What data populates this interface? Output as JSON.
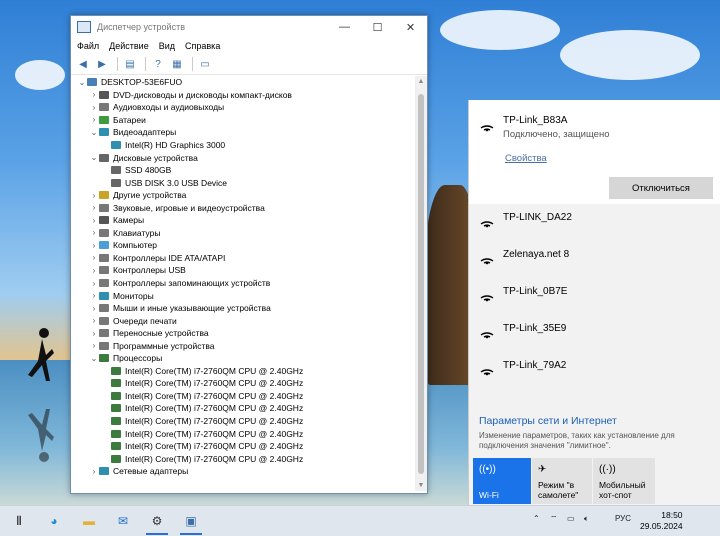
{
  "device_manager": {
    "title": "Диспетчер устройств",
    "menu": [
      "Файл",
      "Действие",
      "Вид",
      "Справка"
    ],
    "tree": [
      {
        "level": 0,
        "exp": "v",
        "icon": "computer-icon",
        "color": "#4a7fb5",
        "label": "DESKTOP-53E6FUO"
      },
      {
        "level": 1,
        "exp": ">",
        "icon": "dvd-icon",
        "color": "#555",
        "label": "DVD-дисководы и дисководы компакт-дисков"
      },
      {
        "level": 1,
        "exp": ">",
        "icon": "audio-icon",
        "color": "#777",
        "label": "Аудиовходы и аудиовыходы"
      },
      {
        "level": 1,
        "exp": ">",
        "icon": "battery-icon",
        "color": "#3d9a3d",
        "label": "Батареи"
      },
      {
        "level": 1,
        "exp": "v",
        "icon": "display-adapter-icon",
        "color": "#2f8fb0",
        "label": "Видеоадаптеры"
      },
      {
        "level": 2,
        "exp": "",
        "icon": "display-adapter-icon",
        "color": "#2f8fb0",
        "label": "Intel(R) HD Graphics 3000"
      },
      {
        "level": 1,
        "exp": "v",
        "icon": "disk-icon",
        "color": "#666",
        "label": "Дисковые устройства"
      },
      {
        "level": 2,
        "exp": "",
        "icon": "disk-icon",
        "color": "#666",
        "label": "SSD 480GB"
      },
      {
        "level": 2,
        "exp": "",
        "icon": "disk-icon",
        "color": "#666",
        "label": "USB DISK 3.0 USB Device"
      },
      {
        "level": 1,
        "exp": ">",
        "icon": "other-devices-icon",
        "color": "#c9a227",
        "label": "Другие устройства"
      },
      {
        "level": 1,
        "exp": ">",
        "icon": "sound-icon",
        "color": "#777",
        "label": "Звуковые, игровые и видеоустройства"
      },
      {
        "level": 1,
        "exp": ">",
        "icon": "camera-icon",
        "color": "#555",
        "label": "Камеры"
      },
      {
        "level": 1,
        "exp": ">",
        "icon": "keyboard-icon",
        "color": "#777",
        "label": "Клавиатуры"
      },
      {
        "level": 1,
        "exp": ">",
        "icon": "computer-icon",
        "color": "#4a9fd6",
        "label": "Компьютер"
      },
      {
        "level": 1,
        "exp": ">",
        "icon": "ide-controller-icon",
        "color": "#777",
        "label": "Контроллеры IDE ATA/ATAPI"
      },
      {
        "level": 1,
        "exp": ">",
        "icon": "usb-icon",
        "color": "#777",
        "label": "Контроллеры USB"
      },
      {
        "level": 1,
        "exp": ">",
        "icon": "storage-controller-icon",
        "color": "#777",
        "label": "Контроллеры запоминающих устройств"
      },
      {
        "level": 1,
        "exp": ">",
        "icon": "monitor-icon",
        "color": "#2f8fb0",
        "label": "Мониторы"
      },
      {
        "level": 1,
        "exp": ">",
        "icon": "mouse-icon",
        "color": "#777",
        "label": "Мыши и иные указывающие устройства"
      },
      {
        "level": 1,
        "exp": ">",
        "icon": "print-queue-icon",
        "color": "#777",
        "label": "Очереди печати"
      },
      {
        "level": 1,
        "exp": ">",
        "icon": "portable-device-icon",
        "color": "#777",
        "label": "Переносные устройства"
      },
      {
        "level": 1,
        "exp": ">",
        "icon": "software-device-icon",
        "color": "#777",
        "label": "Программные устройства"
      },
      {
        "level": 1,
        "exp": "v",
        "icon": "processor-icon",
        "color": "#3d7a3d",
        "label": "Процессоры"
      },
      {
        "level": 2,
        "exp": "",
        "icon": "processor-icon",
        "color": "#3d7a3d",
        "label": "Intel(R) Core(TM) i7-2760QM CPU @ 2.40GHz"
      },
      {
        "level": 2,
        "exp": "",
        "icon": "processor-icon",
        "color": "#3d7a3d",
        "label": "Intel(R) Core(TM) i7-2760QM CPU @ 2.40GHz"
      },
      {
        "level": 2,
        "exp": "",
        "icon": "processor-icon",
        "color": "#3d7a3d",
        "label": "Intel(R) Core(TM) i7-2760QM CPU @ 2.40GHz"
      },
      {
        "level": 2,
        "exp": "",
        "icon": "processor-icon",
        "color": "#3d7a3d",
        "label": "Intel(R) Core(TM) i7-2760QM CPU @ 2.40GHz"
      },
      {
        "level": 2,
        "exp": "",
        "icon": "processor-icon",
        "color": "#3d7a3d",
        "label": "Intel(R) Core(TM) i7-2760QM CPU @ 2.40GHz"
      },
      {
        "level": 2,
        "exp": "",
        "icon": "processor-icon",
        "color": "#3d7a3d",
        "label": "Intel(R) Core(TM) i7-2760QM CPU @ 2.40GHz"
      },
      {
        "level": 2,
        "exp": "",
        "icon": "processor-icon",
        "color": "#3d7a3d",
        "label": "Intel(R) Core(TM) i7-2760QM CPU @ 2.40GHz"
      },
      {
        "level": 2,
        "exp": "",
        "icon": "processor-icon",
        "color": "#3d7a3d",
        "label": "Intel(R) Core(TM) i7-2760QM CPU @ 2.40GHz"
      },
      {
        "level": 1,
        "exp": ">",
        "icon": "network-adapter-icon",
        "color": "#2f8fb0",
        "label": "Сетевые адаптеры"
      }
    ]
  },
  "network_flyout": {
    "connected": {
      "name": "TP-Link_B83A",
      "status": "Подключено, защищено",
      "properties_link": "Свойства",
      "disconnect_button": "Отключиться"
    },
    "networks": [
      "TP-LINK_DA22",
      "Zelenaya.net 8",
      "TP-Link_0B7E",
      "TP-Link_35E9",
      "TP-Link_79A2"
    ],
    "settings_title": "Параметры сети и Интернет",
    "settings_desc": "Изменение параметров, таких как установление для подключения значения \"лимитное\".",
    "quick_actions": [
      {
        "label": "Wi-Fi",
        "active": true,
        "icon": "wifi-icon"
      },
      {
        "label": "Режим \"в самолете\"",
        "active": false,
        "icon": "airplane-icon"
      },
      {
        "label": "Мобильный хот-спот",
        "active": false,
        "icon": "hotspot-icon"
      }
    ],
    "accent_color": "#1a73e8"
  },
  "taskbar": {
    "language": "РУС",
    "time": "18:50",
    "date": "29.05.2024",
    "apps": [
      "task-view-icon",
      "edge-icon",
      "file-explorer-icon",
      "mail-icon",
      "settings-icon",
      "device-manager-icon"
    ]
  }
}
